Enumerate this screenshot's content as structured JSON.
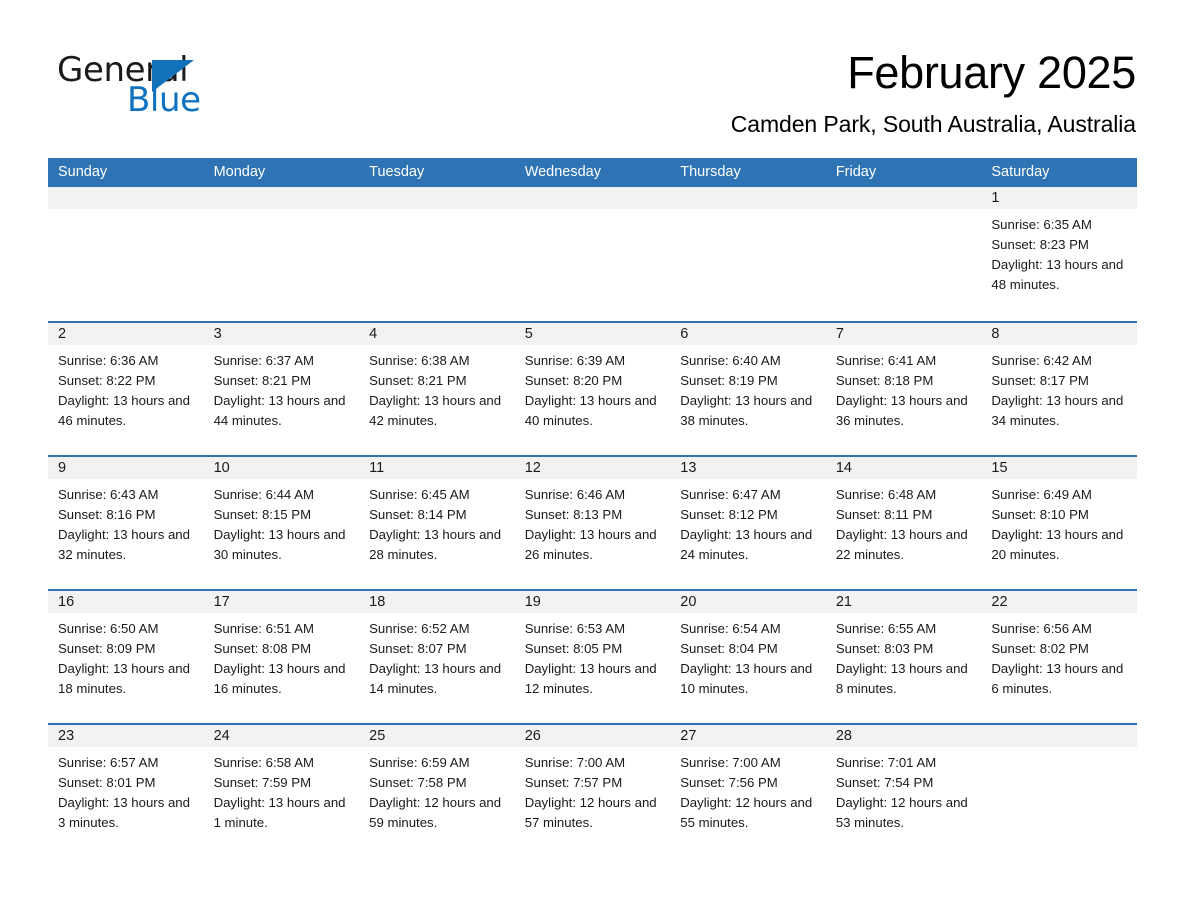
{
  "brand": {
    "name_part1": "General",
    "name_part2": "Blue",
    "logo_icon": "triangle-logo-icon",
    "accent_color": "#1472ba"
  },
  "header": {
    "month_title": "February 2025",
    "location": "Camden Park, South Australia, Australia"
  },
  "theme": {
    "header_blue": "#2e74b5",
    "day_band_gray": "#f2f2f2",
    "text_color": "#1a1a1a"
  },
  "calendar": {
    "weekdays": [
      "Sunday",
      "Monday",
      "Tuesday",
      "Wednesday",
      "Thursday",
      "Friday",
      "Saturday"
    ],
    "weeks": [
      [
        {
          "day": "",
          "empty": true
        },
        {
          "day": "",
          "empty": true
        },
        {
          "day": "",
          "empty": true
        },
        {
          "day": "",
          "empty": true
        },
        {
          "day": "",
          "empty": true
        },
        {
          "day": "",
          "empty": true
        },
        {
          "day": "1",
          "sunrise": "Sunrise: 6:35 AM",
          "sunset": "Sunset: 8:23 PM",
          "daylight": "Daylight: 13 hours and 48 minutes."
        }
      ],
      [
        {
          "day": "2",
          "sunrise": "Sunrise: 6:36 AM",
          "sunset": "Sunset: 8:22 PM",
          "daylight": "Daylight: 13 hours and 46 minutes."
        },
        {
          "day": "3",
          "sunrise": "Sunrise: 6:37 AM",
          "sunset": "Sunset: 8:21 PM",
          "daylight": "Daylight: 13 hours and 44 minutes."
        },
        {
          "day": "4",
          "sunrise": "Sunrise: 6:38 AM",
          "sunset": "Sunset: 8:21 PM",
          "daylight": "Daylight: 13 hours and 42 minutes."
        },
        {
          "day": "5",
          "sunrise": "Sunrise: 6:39 AM",
          "sunset": "Sunset: 8:20 PM",
          "daylight": "Daylight: 13 hours and 40 minutes."
        },
        {
          "day": "6",
          "sunrise": "Sunrise: 6:40 AM",
          "sunset": "Sunset: 8:19 PM",
          "daylight": "Daylight: 13 hours and 38 minutes."
        },
        {
          "day": "7",
          "sunrise": "Sunrise: 6:41 AM",
          "sunset": "Sunset: 8:18 PM",
          "daylight": "Daylight: 13 hours and 36 minutes."
        },
        {
          "day": "8",
          "sunrise": "Sunrise: 6:42 AM",
          "sunset": "Sunset: 8:17 PM",
          "daylight": "Daylight: 13 hours and 34 minutes."
        }
      ],
      [
        {
          "day": "9",
          "sunrise": "Sunrise: 6:43 AM",
          "sunset": "Sunset: 8:16 PM",
          "daylight": "Daylight: 13 hours and 32 minutes."
        },
        {
          "day": "10",
          "sunrise": "Sunrise: 6:44 AM",
          "sunset": "Sunset: 8:15 PM",
          "daylight": "Daylight: 13 hours and 30 minutes."
        },
        {
          "day": "11",
          "sunrise": "Sunrise: 6:45 AM",
          "sunset": "Sunset: 8:14 PM",
          "daylight": "Daylight: 13 hours and 28 minutes."
        },
        {
          "day": "12",
          "sunrise": "Sunrise: 6:46 AM",
          "sunset": "Sunset: 8:13 PM",
          "daylight": "Daylight: 13 hours and 26 minutes."
        },
        {
          "day": "13",
          "sunrise": "Sunrise: 6:47 AM",
          "sunset": "Sunset: 8:12 PM",
          "daylight": "Daylight: 13 hours and 24 minutes."
        },
        {
          "day": "14",
          "sunrise": "Sunrise: 6:48 AM",
          "sunset": "Sunset: 8:11 PM",
          "daylight": "Daylight: 13 hours and 22 minutes."
        },
        {
          "day": "15",
          "sunrise": "Sunrise: 6:49 AM",
          "sunset": "Sunset: 8:10 PM",
          "daylight": "Daylight: 13 hours and 20 minutes."
        }
      ],
      [
        {
          "day": "16",
          "sunrise": "Sunrise: 6:50 AM",
          "sunset": "Sunset: 8:09 PM",
          "daylight": "Daylight: 13 hours and 18 minutes."
        },
        {
          "day": "17",
          "sunrise": "Sunrise: 6:51 AM",
          "sunset": "Sunset: 8:08 PM",
          "daylight": "Daylight: 13 hours and 16 minutes."
        },
        {
          "day": "18",
          "sunrise": "Sunrise: 6:52 AM",
          "sunset": "Sunset: 8:07 PM",
          "daylight": "Daylight: 13 hours and 14 minutes."
        },
        {
          "day": "19",
          "sunrise": "Sunrise: 6:53 AM",
          "sunset": "Sunset: 8:05 PM",
          "daylight": "Daylight: 13 hours and 12 minutes."
        },
        {
          "day": "20",
          "sunrise": "Sunrise: 6:54 AM",
          "sunset": "Sunset: 8:04 PM",
          "daylight": "Daylight: 13 hours and 10 minutes."
        },
        {
          "day": "21",
          "sunrise": "Sunrise: 6:55 AM",
          "sunset": "Sunset: 8:03 PM",
          "daylight": "Daylight: 13 hours and 8 minutes."
        },
        {
          "day": "22",
          "sunrise": "Sunrise: 6:56 AM",
          "sunset": "Sunset: 8:02 PM",
          "daylight": "Daylight: 13 hours and 6 minutes."
        }
      ],
      [
        {
          "day": "23",
          "sunrise": "Sunrise: 6:57 AM",
          "sunset": "Sunset: 8:01 PM",
          "daylight": "Daylight: 13 hours and 3 minutes."
        },
        {
          "day": "24",
          "sunrise": "Sunrise: 6:58 AM",
          "sunset": "Sunset: 7:59 PM",
          "daylight": "Daylight: 13 hours and 1 minute."
        },
        {
          "day": "25",
          "sunrise": "Sunrise: 6:59 AM",
          "sunset": "Sunset: 7:58 PM",
          "daylight": "Daylight: 12 hours and 59 minutes."
        },
        {
          "day": "26",
          "sunrise": "Sunrise: 7:00 AM",
          "sunset": "Sunset: 7:57 PM",
          "daylight": "Daylight: 12 hours and 57 minutes."
        },
        {
          "day": "27",
          "sunrise": "Sunrise: 7:00 AM",
          "sunset": "Sunset: 7:56 PM",
          "daylight": "Daylight: 12 hours and 55 minutes."
        },
        {
          "day": "28",
          "sunrise": "Sunrise: 7:01 AM",
          "sunset": "Sunset: 7:54 PM",
          "daylight": "Daylight: 12 hours and 53 minutes."
        },
        {
          "day": "",
          "empty": true,
          "blank_tail": true
        }
      ]
    ]
  }
}
